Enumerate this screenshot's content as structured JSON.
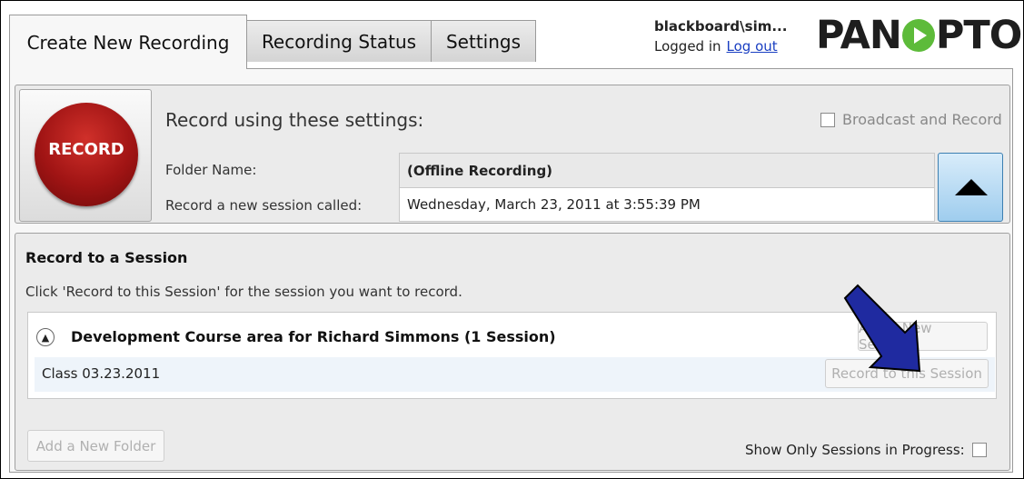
{
  "tabs": [
    {
      "label": "Create New Recording",
      "active": true
    },
    {
      "label": "Recording Status",
      "active": false
    },
    {
      "label": "Settings",
      "active": false
    }
  ],
  "user": {
    "name": "blackboard\\sim...",
    "status": "Logged in",
    "logout": "Log out"
  },
  "brand": {
    "left": "PAN",
    "right": "PTO"
  },
  "record_button": {
    "label": "RECORD"
  },
  "settings": {
    "heading": "Record using these settings:",
    "broadcast_label": "Broadcast and Record",
    "folder_label": "Folder Name:",
    "folder_value": "(Offline Recording)",
    "session_label": "Record a new session called:",
    "session_value": "Wednesday, March 23, 2011 at 3:55:39 PM"
  },
  "session_section": {
    "title": "Record to a Session",
    "description": "Click 'Record to this Session' for the session you want to record.",
    "folder_title": "Development Course area for Richard Simmons (1 Session)",
    "add_session": "Add a New Session",
    "session_name": "Class 03.23.2011",
    "record_session": "Record to this Session"
  },
  "footer": {
    "add_folder": "Add a New Folder",
    "show_only": "Show Only Sessions in Progress:"
  },
  "colors": {
    "record_red": "#a01414",
    "arrow_blue": "#1f2aa0",
    "accent_blue": "#9fcdee"
  }
}
